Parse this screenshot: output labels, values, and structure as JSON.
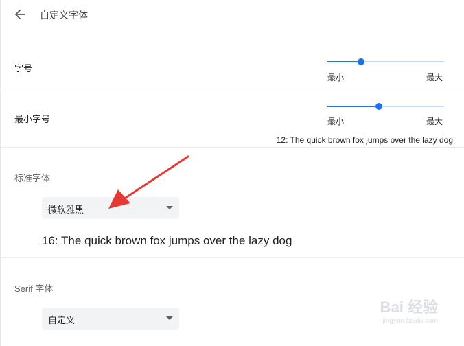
{
  "header": {
    "title": "自定义字体"
  },
  "font_size": {
    "label": "字号",
    "level": 0.29,
    "min_label": "最小",
    "max_label": "最大"
  },
  "min_font_size": {
    "label": "最小字号",
    "level": 0.44,
    "min_label": "最小",
    "max_label": "最大",
    "sample": "12: The quick brown fox jumps over the lazy dog"
  },
  "standard_font": {
    "label": "标准字体",
    "selected": "微软雅黑",
    "sample": "16: The quick brown fox jumps over the lazy dog"
  },
  "serif_font": {
    "label": "Serif 字体",
    "selected": "自定义"
  },
  "watermark": {
    "text": "Bai 经验",
    "sub": "jingyan.baidu.com"
  },
  "colors": {
    "accent": "#1a73e8",
    "arrow": "#e53935"
  }
}
